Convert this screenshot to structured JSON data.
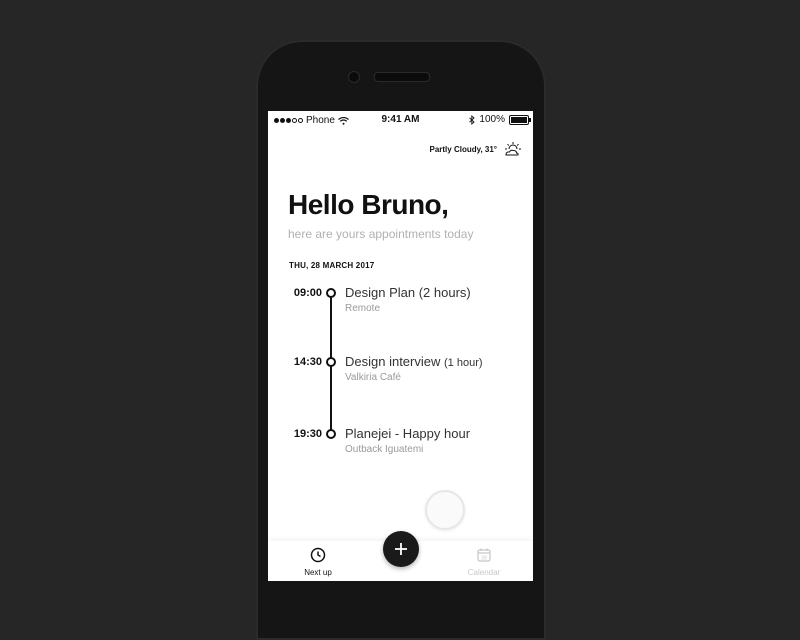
{
  "status_bar": {
    "carrier": "Phone",
    "time": "9:41 AM",
    "battery": "100%"
  },
  "weather": {
    "text": "Partly Cloudy, 31°",
    "icon": "partly-cloudy-icon"
  },
  "greeting": {
    "title": "Hello Bruno,",
    "subtitle": "here are yours appointments today"
  },
  "date": "THU, 28 MARCH 2017",
  "appointments": [
    {
      "time": "09:00",
      "title": "Design Plan (2 hours)",
      "duration": "",
      "location": "Remote"
    },
    {
      "time": "14:30",
      "title": "Design interview",
      "duration": "(1 hour)",
      "location": "Valkiria Café"
    },
    {
      "time": "19:30",
      "title": "Planejei - Happy hour",
      "duration": "",
      "location": "Outback Iguatemi"
    }
  ],
  "tab_bar": {
    "next_up": {
      "label": "Next up",
      "icon": "clock-icon"
    },
    "add": {
      "icon": "plus-icon"
    },
    "calendar": {
      "label": "Calendar",
      "icon": "calendar-icon",
      "day": "28"
    }
  },
  "colors": {
    "background": "#262626",
    "phone": "#151515",
    "text": "#111111",
    "muted": "#9a9a9a",
    "fab": "#1a1a1a"
  }
}
